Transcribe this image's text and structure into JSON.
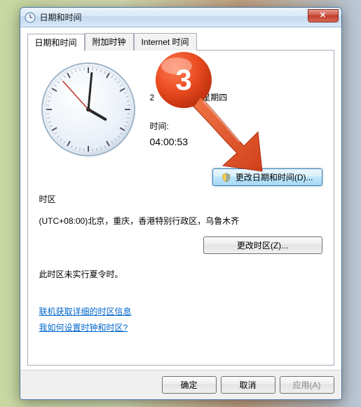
{
  "window": {
    "title": "日期和时间"
  },
  "tabs": [
    {
      "label": "日期和时间"
    },
    {
      "label": "附加时钟"
    },
    {
      "label": "Internet 时间"
    }
  ],
  "datetime": {
    "date_partial": "2",
    "weekday_partial": "星期四",
    "time_label": "时间:",
    "time_value": "04:00:53",
    "change_button": "更改日期和时间(D)..."
  },
  "timezone": {
    "label": "时区",
    "value": "(UTC+08:00)北京，重庆，香港特别行政区，乌鲁木齐",
    "change_button": "更改时区(Z)...",
    "dst_note": "此时区未实行夏令时。"
  },
  "links": {
    "online_info": "联机获取详细的时区信息",
    "how_to": "我如何设置时钟和时区?"
  },
  "footer": {
    "ok": "确定",
    "cancel": "取消",
    "apply": "应用(A)"
  },
  "clock": {
    "hour": 4,
    "minute": 0,
    "second": 53
  },
  "annotation": {
    "step": "3"
  }
}
